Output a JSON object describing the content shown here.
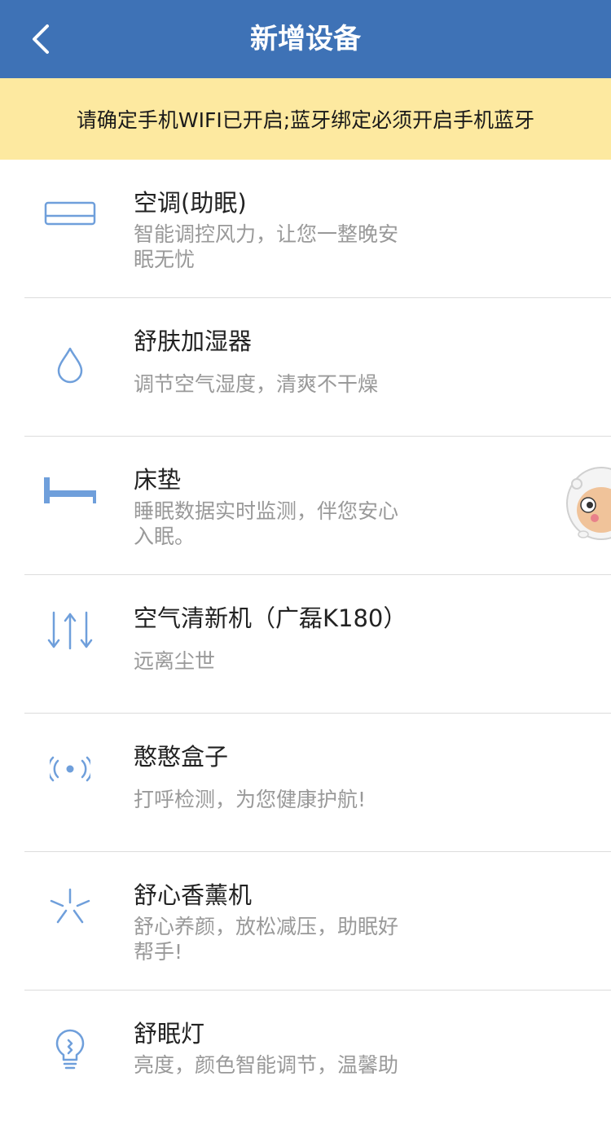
{
  "header": {
    "title": "新增设备",
    "back_icon": "chevron-left-icon"
  },
  "notice": {
    "text": "请确定手机WIFI已开启;蓝牙绑定必须开启手机蓝牙"
  },
  "devices": [
    {
      "name": "空调(助眠)",
      "desc": "智能调控风力，让您一整晚安眠无忧",
      "icon": "air-conditioner-icon"
    },
    {
      "name": "舒肤加湿器",
      "desc": "调节空气湿度，清爽不干燥",
      "icon": "water-drop-icon"
    },
    {
      "name": "床垫",
      "desc": "睡眠数据实时监测，伴您安心入眠。",
      "icon": "bed-icon"
    },
    {
      "name": "空气清新机（广磊K180）",
      "desc": "远离尘世",
      "icon": "air-flow-icon"
    },
    {
      "name": "憨憨盒子",
      "desc": "打呼检测，为您健康护航!",
      "icon": "signal-broadcast-icon"
    },
    {
      "name": "舒心香薰机",
      "desc": "舒心养颜，放松减压，助眠好帮手!",
      "icon": "sparkle-icon"
    },
    {
      "name": "舒眠灯",
      "desc": "亮度，颜色智能调节，温馨助",
      "icon": "light-bulb-icon"
    }
  ],
  "colors": {
    "header_bg": "#3e72b6",
    "notice_bg": "#fde9a0",
    "icon": "#6f9fdb"
  }
}
